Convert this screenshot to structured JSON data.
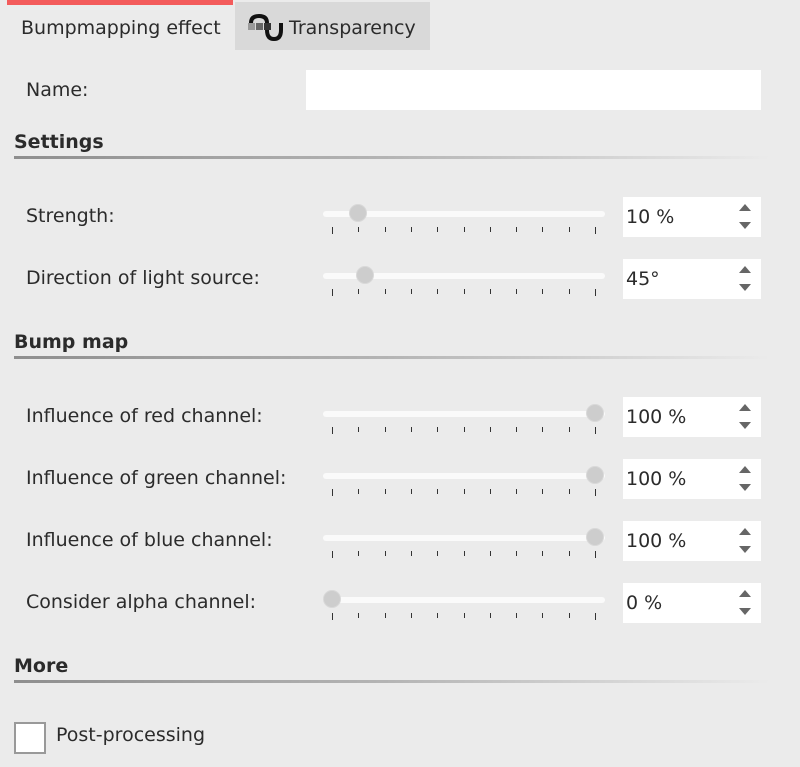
{
  "tabs": [
    {
      "label": "Bumpmapping effect",
      "active": true
    },
    {
      "label": "Transparency",
      "active": false,
      "icon": "transparency-icon"
    }
  ],
  "colors": {
    "active_tab_indicator": "#f35b5b",
    "background": "#ebebeb",
    "inactive_tab": "#d9d9d9"
  },
  "name_field": {
    "label": "Name:",
    "value": "",
    "placeholder": ""
  },
  "sections": {
    "settings": {
      "title": "Settings",
      "rows": [
        {
          "label": "Strength:",
          "value": "10 %",
          "fraction": 0.1
        },
        {
          "label": "Direction of light source:",
          "value": "45°",
          "fraction": 0.125
        }
      ]
    },
    "bump_map": {
      "title": "Bump map",
      "rows": [
        {
          "label": "Influence of red channel:",
          "value": "100 %",
          "fraction": 1.0
        },
        {
          "label": "Influence of green channel:",
          "value": "100 %",
          "fraction": 1.0
        },
        {
          "label": "Influence of blue channel:",
          "value": "100 %",
          "fraction": 1.0
        },
        {
          "label": "Consider alpha channel:",
          "value": "0 %",
          "fraction": 0.0
        }
      ]
    },
    "more": {
      "title": "More",
      "post_processing": {
        "label": "Post-processing",
        "checked": false
      }
    }
  }
}
